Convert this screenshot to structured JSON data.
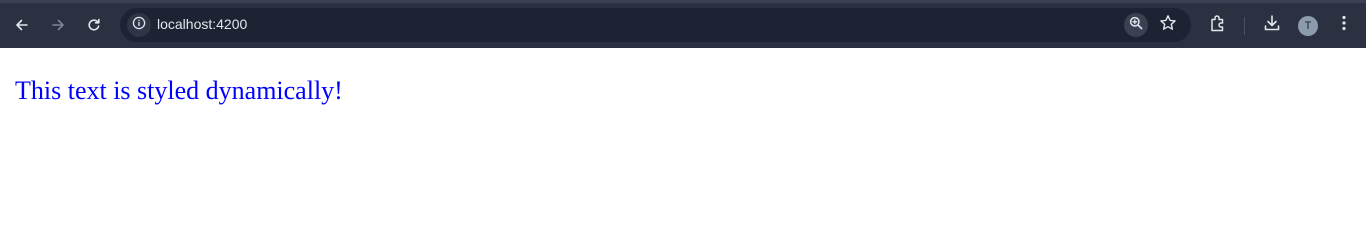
{
  "browser": {
    "url": "localhost:4200",
    "profile_initial": "T",
    "icons": {
      "back": "arrow-left-icon",
      "forward": "arrow-right-icon",
      "reload": "reload-icon",
      "site_info": "info-icon",
      "zoom": "zoom-in-icon",
      "bookmark": "star-icon",
      "extensions": "puzzle-icon",
      "downloads": "download-icon",
      "menu": "kebab-menu-icon"
    },
    "colors": {
      "toolbar": "#2b3140",
      "omnibox": "#1d2333",
      "icon": "#e3e6ec",
      "icon_disabled": "#7d8494"
    }
  },
  "page": {
    "text": "This text is styled dynamically!",
    "text_color": "#0000ff"
  }
}
